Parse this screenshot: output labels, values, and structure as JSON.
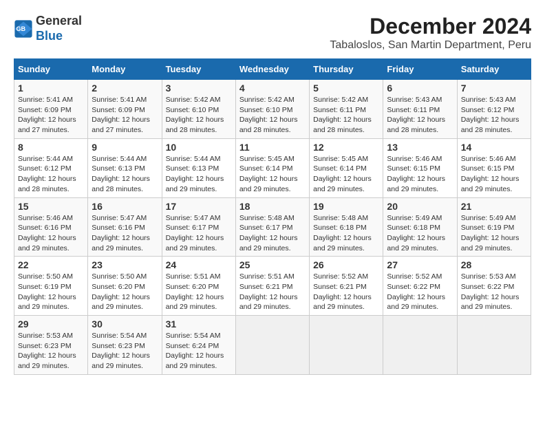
{
  "header": {
    "logo_line1": "General",
    "logo_line2": "Blue",
    "month_year": "December 2024",
    "location": "Tabaloslos, San Martin Department, Peru"
  },
  "weekdays": [
    "Sunday",
    "Monday",
    "Tuesday",
    "Wednesday",
    "Thursday",
    "Friday",
    "Saturday"
  ],
  "weeks": [
    [
      {
        "day": "1",
        "info": "Sunrise: 5:41 AM\nSunset: 6:09 PM\nDaylight: 12 hours and 27 minutes."
      },
      {
        "day": "2",
        "info": "Sunrise: 5:41 AM\nSunset: 6:09 PM\nDaylight: 12 hours and 27 minutes."
      },
      {
        "day": "3",
        "info": "Sunrise: 5:42 AM\nSunset: 6:10 PM\nDaylight: 12 hours and 28 minutes."
      },
      {
        "day": "4",
        "info": "Sunrise: 5:42 AM\nSunset: 6:10 PM\nDaylight: 12 hours and 28 minutes."
      },
      {
        "day": "5",
        "info": "Sunrise: 5:42 AM\nSunset: 6:11 PM\nDaylight: 12 hours and 28 minutes."
      },
      {
        "day": "6",
        "info": "Sunrise: 5:43 AM\nSunset: 6:11 PM\nDaylight: 12 hours and 28 minutes."
      },
      {
        "day": "7",
        "info": "Sunrise: 5:43 AM\nSunset: 6:12 PM\nDaylight: 12 hours and 28 minutes."
      }
    ],
    [
      {
        "day": "8",
        "info": "Sunrise: 5:44 AM\nSunset: 6:12 PM\nDaylight: 12 hours and 28 minutes."
      },
      {
        "day": "9",
        "info": "Sunrise: 5:44 AM\nSunset: 6:13 PM\nDaylight: 12 hours and 28 minutes."
      },
      {
        "day": "10",
        "info": "Sunrise: 5:44 AM\nSunset: 6:13 PM\nDaylight: 12 hours and 29 minutes."
      },
      {
        "day": "11",
        "info": "Sunrise: 5:45 AM\nSunset: 6:14 PM\nDaylight: 12 hours and 29 minutes."
      },
      {
        "day": "12",
        "info": "Sunrise: 5:45 AM\nSunset: 6:14 PM\nDaylight: 12 hours and 29 minutes."
      },
      {
        "day": "13",
        "info": "Sunrise: 5:46 AM\nSunset: 6:15 PM\nDaylight: 12 hours and 29 minutes."
      },
      {
        "day": "14",
        "info": "Sunrise: 5:46 AM\nSunset: 6:15 PM\nDaylight: 12 hours and 29 minutes."
      }
    ],
    [
      {
        "day": "15",
        "info": "Sunrise: 5:46 AM\nSunset: 6:16 PM\nDaylight: 12 hours and 29 minutes."
      },
      {
        "day": "16",
        "info": "Sunrise: 5:47 AM\nSunset: 6:16 PM\nDaylight: 12 hours and 29 minutes."
      },
      {
        "day": "17",
        "info": "Sunrise: 5:47 AM\nSunset: 6:17 PM\nDaylight: 12 hours and 29 minutes."
      },
      {
        "day": "18",
        "info": "Sunrise: 5:48 AM\nSunset: 6:17 PM\nDaylight: 12 hours and 29 minutes."
      },
      {
        "day": "19",
        "info": "Sunrise: 5:48 AM\nSunset: 6:18 PM\nDaylight: 12 hours and 29 minutes."
      },
      {
        "day": "20",
        "info": "Sunrise: 5:49 AM\nSunset: 6:18 PM\nDaylight: 12 hours and 29 minutes."
      },
      {
        "day": "21",
        "info": "Sunrise: 5:49 AM\nSunset: 6:19 PM\nDaylight: 12 hours and 29 minutes."
      }
    ],
    [
      {
        "day": "22",
        "info": "Sunrise: 5:50 AM\nSunset: 6:19 PM\nDaylight: 12 hours and 29 minutes."
      },
      {
        "day": "23",
        "info": "Sunrise: 5:50 AM\nSunset: 6:20 PM\nDaylight: 12 hours and 29 minutes."
      },
      {
        "day": "24",
        "info": "Sunrise: 5:51 AM\nSunset: 6:20 PM\nDaylight: 12 hours and 29 minutes."
      },
      {
        "day": "25",
        "info": "Sunrise: 5:51 AM\nSunset: 6:21 PM\nDaylight: 12 hours and 29 minutes."
      },
      {
        "day": "26",
        "info": "Sunrise: 5:52 AM\nSunset: 6:21 PM\nDaylight: 12 hours and 29 minutes."
      },
      {
        "day": "27",
        "info": "Sunrise: 5:52 AM\nSunset: 6:22 PM\nDaylight: 12 hours and 29 minutes."
      },
      {
        "day": "28",
        "info": "Sunrise: 5:53 AM\nSunset: 6:22 PM\nDaylight: 12 hours and 29 minutes."
      }
    ],
    [
      {
        "day": "29",
        "info": "Sunrise: 5:53 AM\nSunset: 6:23 PM\nDaylight: 12 hours and 29 minutes."
      },
      {
        "day": "30",
        "info": "Sunrise: 5:54 AM\nSunset: 6:23 PM\nDaylight: 12 hours and 29 minutes."
      },
      {
        "day": "31",
        "info": "Sunrise: 5:54 AM\nSunset: 6:24 PM\nDaylight: 12 hours and 29 minutes."
      },
      {
        "day": "",
        "info": ""
      },
      {
        "day": "",
        "info": ""
      },
      {
        "day": "",
        "info": ""
      },
      {
        "day": "",
        "info": ""
      }
    ]
  ]
}
